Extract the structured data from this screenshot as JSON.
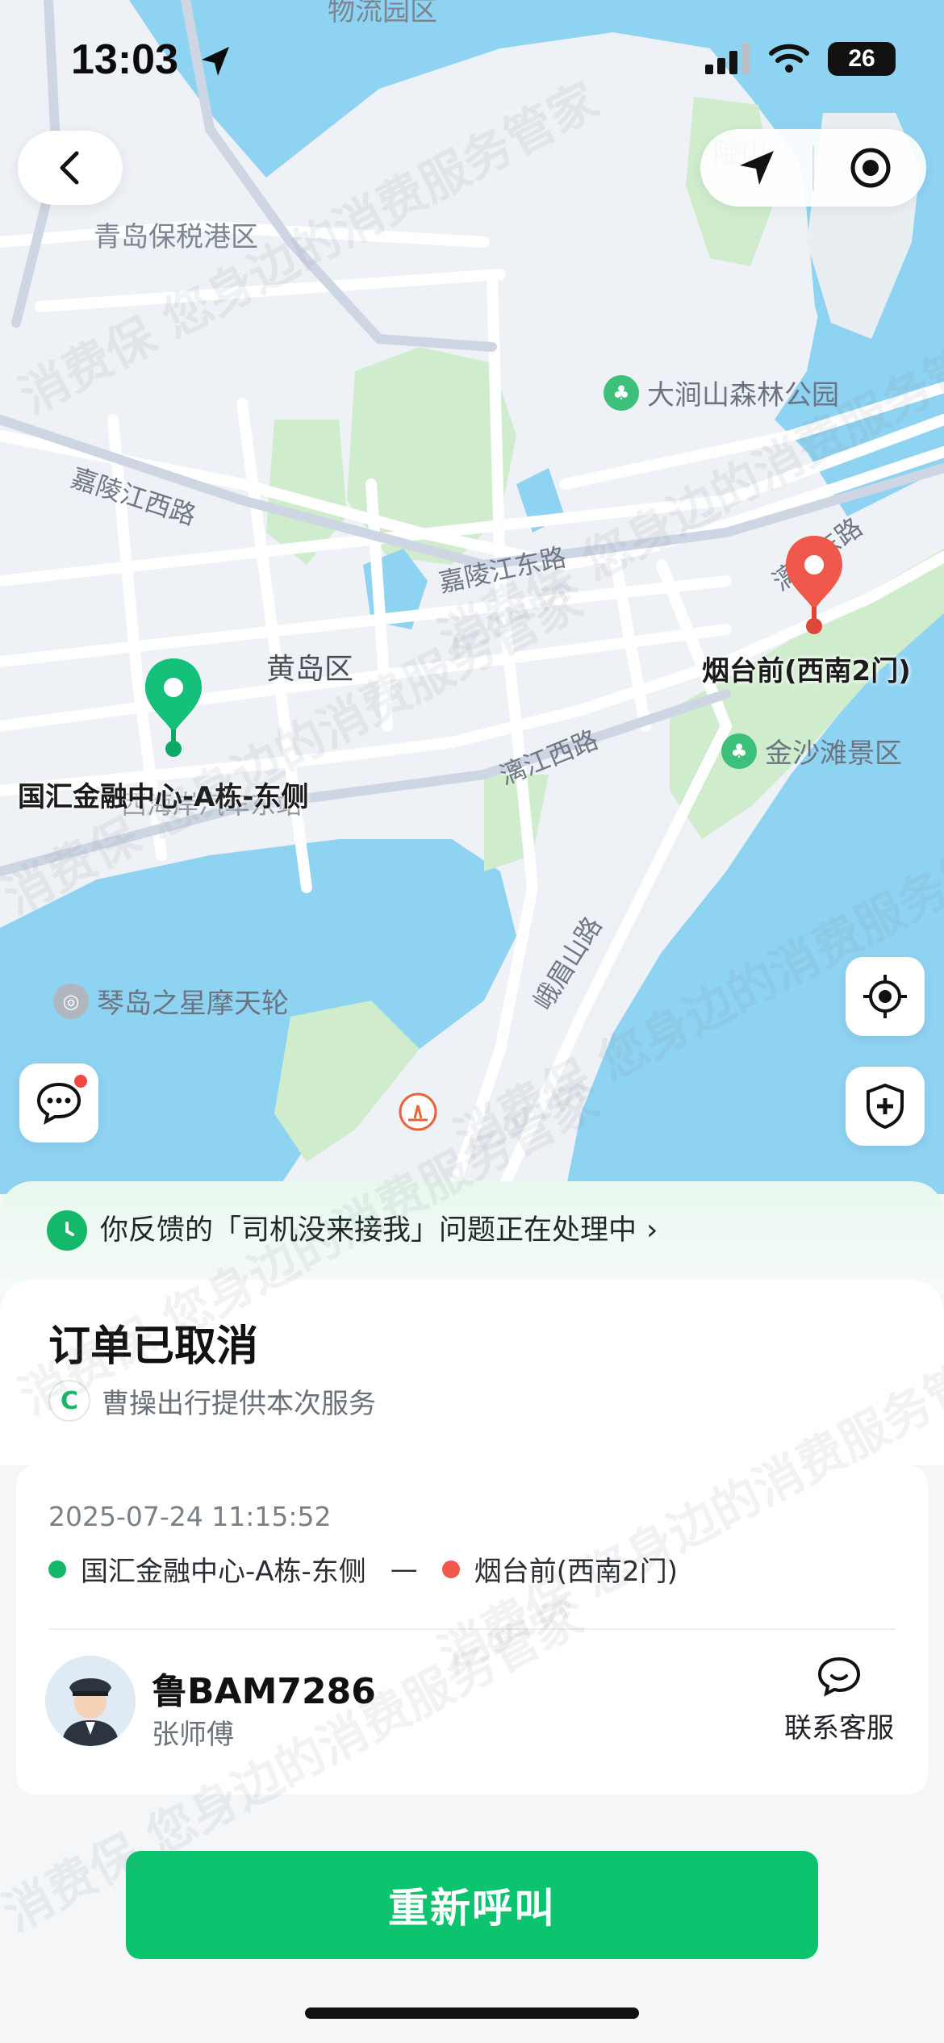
{
  "status_bar": {
    "time": "13:03",
    "battery": "26"
  },
  "map": {
    "labels": {
      "logistics_park": "物流园区",
      "bonded_port": "青岛保税港区",
      "hill": "陡山",
      "forest_park": "大涧山森林公园",
      "road_jialingjiang_w": "嘉陵江西路",
      "road_jialingjiang_e": "嘉陵江东路",
      "road_lijiang_w": "漓江西路",
      "road_lijiang_e": "漓江东路",
      "road_qiaoshan": "峨眉山路",
      "district": "黄岛区",
      "beach": "金沙滩景区",
      "station": "西海岸汽车东站",
      "ferris_wheel": "琴岛之星摩天轮"
    },
    "pins": {
      "start": "国汇金融中心-A栋-东侧",
      "end": "烟台前(西南2门)"
    }
  },
  "notice": {
    "text": "你反馈的「司机没来接我」问题正在处理中",
    "arrow": "›"
  },
  "order": {
    "status": "订单已取消",
    "provider_logo": "C",
    "provider": "曹操出行提供本次服务",
    "time": "2025-07-24 11:15:52",
    "from": "国汇金融中心-A栋-东侧",
    "dash": "—",
    "to": "烟台前(西南2门)",
    "plate": "鲁BAM7286",
    "driver": "张师傅",
    "contact": "联系客服"
  },
  "actions": {
    "recall": "重新呼叫"
  },
  "watermark": "消费保 您身边的消费服务管家",
  "colors": {
    "brand_green": "#0dc46e",
    "end_red": "#f0584b",
    "water": "#8fd3f2",
    "park": "#cfeccd"
  }
}
